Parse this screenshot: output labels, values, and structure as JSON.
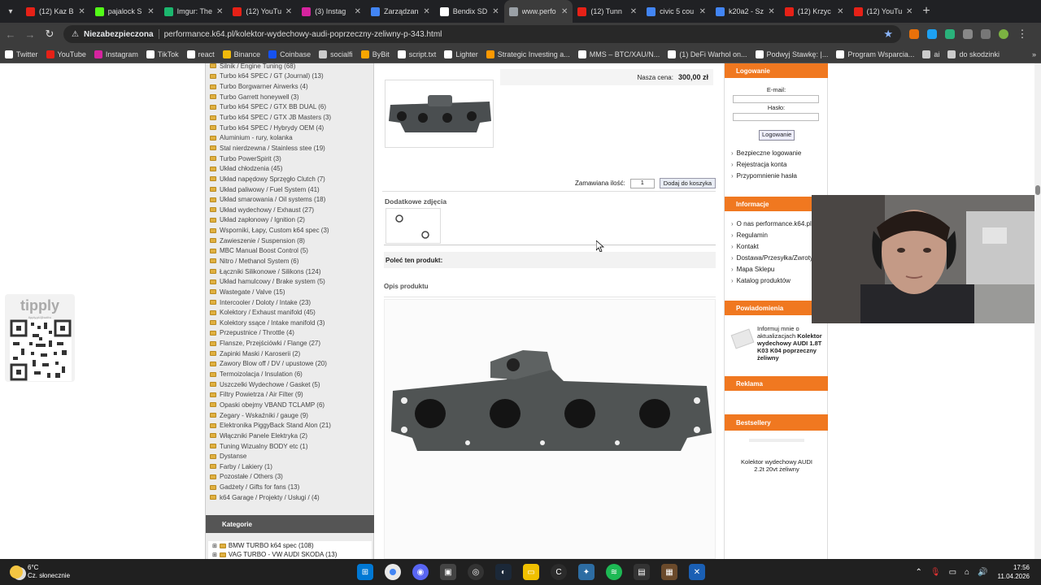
{
  "browser": {
    "tabs": [
      {
        "title": "(12) Kaz B",
        "color": "#e62117"
      },
      {
        "title": "pajalock S",
        "color": "#53fc18"
      },
      {
        "title": "Imgur: The",
        "color": "#1bb76e"
      },
      {
        "title": "(12) YouTu",
        "color": "#e62117"
      },
      {
        "title": "(3) Instag",
        "color": "#d6249f"
      },
      {
        "title": "Zarządzan",
        "color": "#4285f4"
      },
      {
        "title": "Bendix SD",
        "color": "#ffffff"
      },
      {
        "title": "www.perfo",
        "color": "#9aa0a6"
      },
      {
        "title": "(12) Tunn",
        "color": "#e62117"
      },
      {
        "title": "civic 5 cou",
        "color": "#4285f4"
      },
      {
        "title": "k20a2 - Sz",
        "color": "#4285f4"
      },
      {
        "title": "(12) Krzyc",
        "color": "#e62117"
      },
      {
        "title": "(12) YouTu",
        "color": "#e62117"
      }
    ],
    "active_tab_index": 7,
    "security_label": "Niezabezpieczona",
    "url": "performance.k64.pl/kolektor-wydechowy-audi-poprzeczny-zeliwny-p-343.html",
    "bookmarks": [
      {
        "label": "Twitter",
        "color": "#ffffff"
      },
      {
        "label": "YouTube",
        "color": "#e62117"
      },
      {
        "label": "Instagram",
        "color": "#d6249f"
      },
      {
        "label": "TikTok",
        "color": "#ffffff"
      },
      {
        "label": "react",
        "color": "#ffffff"
      },
      {
        "label": "Binance",
        "color": "#f0b90b"
      },
      {
        "label": "Coinbase",
        "color": "#1652f0"
      },
      {
        "label": "socialfi",
        "color": "#cccccc"
      },
      {
        "label": "ByBit",
        "color": "#f7a600"
      },
      {
        "label": "script.txt",
        "color": "#ffffff"
      },
      {
        "label": "Lighter",
        "color": "#ffffff"
      },
      {
        "label": "Strategic Investing a...",
        "color": "#ff9900"
      },
      {
        "label": "MMS – BTC/XAU/N...",
        "color": "#ffffff"
      },
      {
        "label": "(1) DeFi Warhol on...",
        "color": "#ffffff"
      },
      {
        "label": "Podwyj Stawkę: |...",
        "color": "#ffffff"
      },
      {
        "label": "Program Wsparcia...",
        "color": "#ffffff"
      },
      {
        "label": "ai",
        "color": "#cccccc"
      },
      {
        "label": "do skodzinki",
        "color": "#cccccc"
      }
    ]
  },
  "left_categories": [
    {
      "label": "Silnik / Engine Tuning (68)"
    },
    {
      "label": "Turbo k64 SPEC / GT (Journal) (13)"
    },
    {
      "label": "Turbo Borgwarner Airwerks (4)"
    },
    {
      "label": "Turbo Garrett honeywell (3)"
    },
    {
      "label": "Turbo k64 SPEC / GTX BB DUAL (6)"
    },
    {
      "label": "Turbo k64 SPEC / GTX JB Masters (3)"
    },
    {
      "label": "Turbo k64 SPEC / Hybrydy OEM (4)"
    },
    {
      "label": "Aluminium - rury, kolanka"
    },
    {
      "label": "Stal nierdzewna / Stainless stee (19)"
    },
    {
      "label": "Turbo PowerSpirit (3)"
    },
    {
      "label": "Układ chłodzenia (45)"
    },
    {
      "label": "Układ napędowy Sprzęgło Clutch (7)"
    },
    {
      "label": "Układ paliwowy / Fuel System (41)"
    },
    {
      "label": "Układ smarowania / Oil systems (18)"
    },
    {
      "label": "Układ wydechowy / Exhaust (27)"
    },
    {
      "label": "Układ zapłonowy / Ignition (2)"
    },
    {
      "label": "Wsporniki, Łapy, Custom k64 spec (3)"
    },
    {
      "label": "Zawieszenie / Suspension (8)"
    },
    {
      "label": "MBC Manual Boost Control (5)"
    },
    {
      "label": "Nitro / Methanol System (6)"
    },
    {
      "label": "Łączniki Silikonowe / Silikons (124)"
    },
    {
      "label": "Układ hamulcowy / Brake system (5)"
    },
    {
      "label": "Wastegate / Valve (15)"
    },
    {
      "label": "Intercooler / Doloty / Intake (23)"
    },
    {
      "label": "Kolektory / Exhaust manifold (45)"
    },
    {
      "label": "Kolektory ssące / Intake manifold (3)"
    },
    {
      "label": "Przepustnice / Throttle (4)"
    },
    {
      "label": "Flansze, Przejściówki / Flange (27)"
    },
    {
      "label": "Zapinki Maski / Karoserii (2)"
    },
    {
      "label": "Zawory Blow off / DV / upustowe (20)"
    },
    {
      "label": "Termoizolacja / Insulation (6)"
    },
    {
      "label": "Uszczelki Wydechowe / Gasket (5)"
    },
    {
      "label": "Filtry Powietrza / Air Filter (9)"
    },
    {
      "label": "Opaski obejmy VBAND TCLAMP (6)"
    },
    {
      "label": "Zegary - Wskaźniki / gauge (9)"
    },
    {
      "label": "Elektronika PiggyBack Stand Alon (21)"
    },
    {
      "label": "Włączniki Panele Elektryka (2)"
    },
    {
      "label": "Tuning Wizualny BODY etc (1)"
    },
    {
      "label": "Dystanse"
    },
    {
      "label": "Farby / Lakiery (1)"
    },
    {
      "label": "Pozostałe / Others (3)"
    },
    {
      "label": "Gadżety / Gifts for fans (13)"
    },
    {
      "label": "k64 Garage / Projekty / Usługi / (4)"
    }
  ],
  "kategorie": {
    "title": "Kategorie",
    "items": [
      {
        "label": "BMW TURBO k64 spec (108)"
      },
      {
        "label": "VAG TURBO - VW AUDI SKODA (13)"
      }
    ]
  },
  "product": {
    "price_label": "Nasza cena:",
    "price_value": "300,00 zł",
    "qty_label": "Zamawiana ilość:",
    "qty_value": "1",
    "add_to_cart": "Dodaj do koszyka",
    "extra_photos": "Dodatkowe zdjęcia",
    "recommend": "Poleć ten produkt:",
    "description_title": "Opis produktu"
  },
  "sidebar_right": {
    "login_title": "Logowanie",
    "email_label": "E-mail:",
    "password_label": "Hasło:",
    "login_button": "Logowanie",
    "login_links": [
      "Bezpieczne logowanie",
      "Rejestracja konta",
      "Przypomnienie hasła"
    ],
    "info_title": "Informacje",
    "info_links": [
      "O nas performance.k64.pl",
      "Regulamin",
      "Kontakt",
      "Dostawa/Przesyłka/Zwroty",
      "Mapa Sklepu",
      "Katalog produktów"
    ],
    "notify_title": "Powiadomienia",
    "notify_text_prefix": "Informuj mnie o aktualizacjach",
    "notify_product": "Kolektor wydechowy AUDI 1.8T K03 K04 poprzeczny żeliwny",
    "ads_title": "Reklama",
    "bestsellers_title": "Bestsellery",
    "bestseller_item": "Kolektor wydechowy AUDI 2.2t 20vt żeliwny"
  },
  "overlay": {
    "tipply_label": "tipply",
    "tipply_url": "tipply.pl/@szifro"
  },
  "taskbar": {
    "weather_temp": "6°C",
    "weather_desc": "Cz. słonecznie",
    "time": "17:56",
    "date": "11.04.2026"
  }
}
